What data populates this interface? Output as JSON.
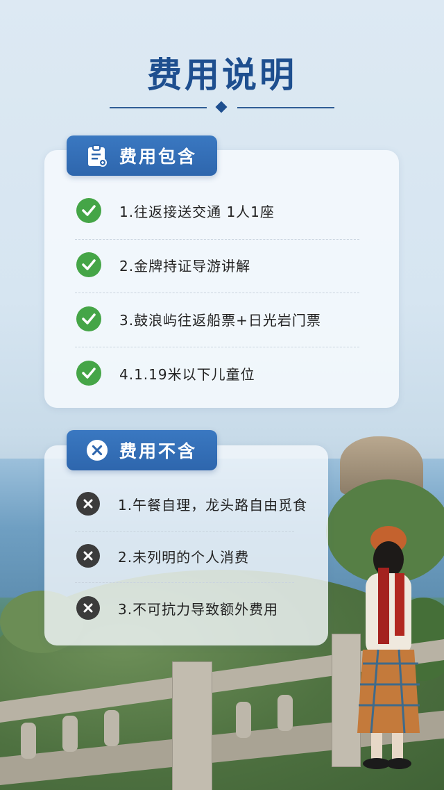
{
  "title": "费用说明",
  "included": {
    "header": "费用包含",
    "header_icon": "clipboard-icon",
    "item_icon": "check-circle-icon",
    "items": [
      "1.往返接送交通 1人1座",
      "2.金牌持证导游讲解",
      "3.鼓浪屿往返船票+日光岩门票",
      "4.1.19米以下儿童位"
    ]
  },
  "excluded": {
    "header": "费用不含",
    "header_icon": "x-circle-icon",
    "item_icon": "x-circle-icon",
    "items": [
      "1.午餐自理，龙头路自由觅食",
      "2.未列明的个人消费",
      "3.不可抗力导致额外费用"
    ]
  },
  "colors": {
    "title": "#1e4f8f",
    "header_bg": "#3a78c1",
    "check": "#45a547",
    "cross": "#3b3b3b"
  }
}
